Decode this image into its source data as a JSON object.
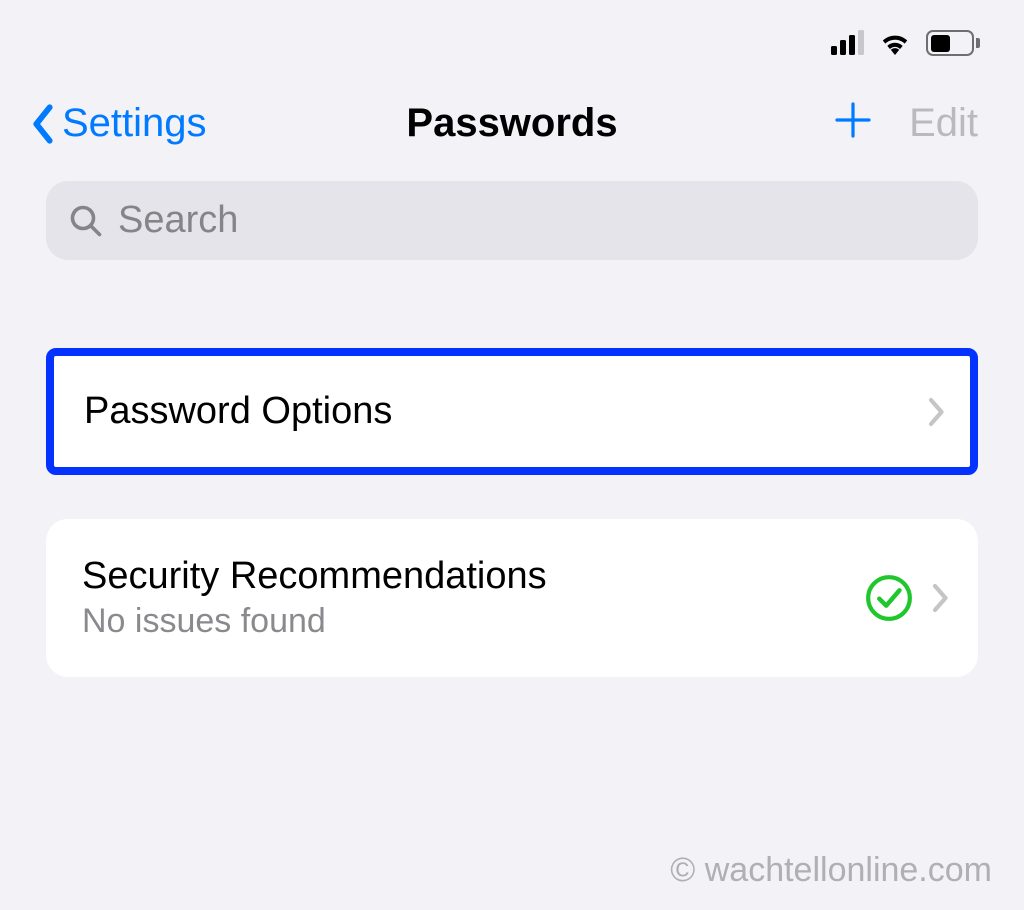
{
  "status": {
    "cellular_bars_active": 3,
    "cellular_bars_total": 4,
    "wifi": true,
    "battery_percent": 44
  },
  "nav": {
    "back_label": "Settings",
    "title": "Passwords",
    "add_label": "+",
    "edit_label": "Edit"
  },
  "search": {
    "placeholder": "Search",
    "value": ""
  },
  "list": {
    "items": [
      {
        "title": "Password Options",
        "subtitle": "",
        "highlighted": true,
        "check": false
      },
      {
        "title": "Security Recommendations",
        "subtitle": "No issues found",
        "highlighted": false,
        "check": true
      }
    ]
  },
  "watermark": "© wachtellonline.com",
  "colors": {
    "accent": "#007aff",
    "highlight_border": "#0433ff",
    "check_green": "#1fc72d"
  }
}
